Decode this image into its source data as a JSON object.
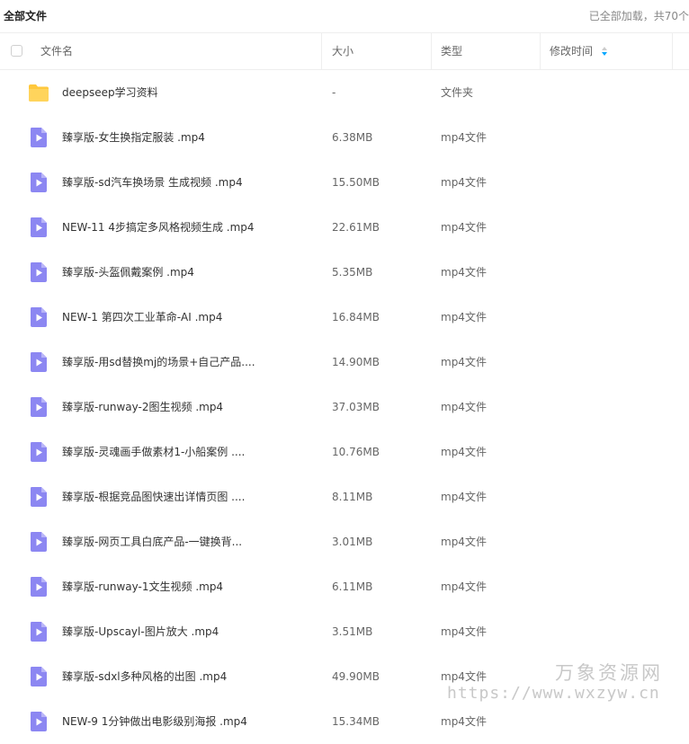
{
  "header": {
    "title": "全部文件",
    "loaded_status": "已全部加载，共70个"
  },
  "columns": {
    "name": "文件名",
    "size": "大小",
    "type": "类型",
    "modified": "修改时间"
  },
  "files": [
    {
      "icon": "folder-icon",
      "name": "deepseep学习资料",
      "size": "-",
      "type": "文件夹"
    },
    {
      "icon": "video-file-icon",
      "name": "臻享版-女生换指定服装 .mp4",
      "size": "6.38MB",
      "type": "mp4文件"
    },
    {
      "icon": "video-file-icon",
      "name": "臻享版-sd汽车换场景 生成视频 .mp4",
      "size": "15.50MB",
      "type": "mp4文件"
    },
    {
      "icon": "video-file-icon",
      "name": "NEW-11 4步搞定多风格视频生成 .mp4",
      "size": "22.61MB",
      "type": "mp4文件"
    },
    {
      "icon": "video-file-icon",
      "name": "臻享版-头盔佩戴案例 .mp4",
      "size": "5.35MB",
      "type": "mp4文件"
    },
    {
      "icon": "video-file-icon",
      "name": "NEW-1 第四次工业革命-AI .mp4",
      "size": "16.84MB",
      "type": "mp4文件"
    },
    {
      "icon": "video-file-icon",
      "name": "臻享版-用sd替换mj的场景+自己产品....",
      "size": "14.90MB",
      "type": "mp4文件"
    },
    {
      "icon": "video-file-icon",
      "name": "臻享版-runway-2图生视频 .mp4",
      "size": "37.03MB",
      "type": "mp4文件"
    },
    {
      "icon": "video-file-icon",
      "name": "臻享版-灵魂画手做素材1-小船案例 ....",
      "size": "10.76MB",
      "type": "mp4文件"
    },
    {
      "icon": "video-file-icon",
      "name": "臻享版-根据竞品图快速出详情页图 ....",
      "size": "8.11MB",
      "type": "mp4文件"
    },
    {
      "icon": "video-file-icon",
      "name": "臻享版-网页工具白底产品-一键换背...",
      "size": "3.01MB",
      "type": "mp4文件"
    },
    {
      "icon": "video-file-icon",
      "name": "臻享版-runway-1文生视频 .mp4",
      "size": "6.11MB",
      "type": "mp4文件"
    },
    {
      "icon": "video-file-icon",
      "name": "臻享版-Upscayl-图片放大 .mp4",
      "size": "3.51MB",
      "type": "mp4文件"
    },
    {
      "icon": "video-file-icon",
      "name": "臻享版-sdxl多种风格的出图 .mp4",
      "size": "49.90MB",
      "type": "mp4文件"
    },
    {
      "icon": "video-file-icon",
      "name": "NEW-9 1分钟做出电影级别海报 .mp4",
      "size": "15.34MB",
      "type": "mp4文件"
    }
  ],
  "watermark": {
    "line1": "万象资源网",
    "line2": "https://www.wxzyw.cn"
  },
  "colors": {
    "folder": "#FFC83D",
    "video_icon": "#8C87F2",
    "sort_active": "#06A7FF"
  }
}
